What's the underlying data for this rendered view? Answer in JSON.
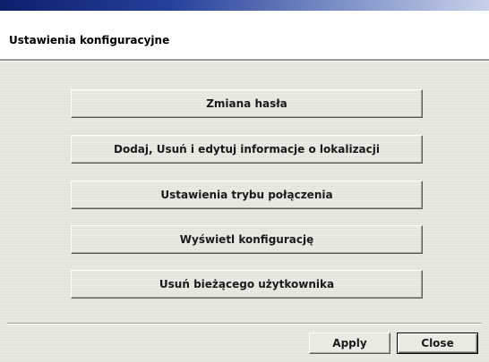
{
  "header": {
    "title": "Ustawienia konfiguracyjne"
  },
  "menu": {
    "buttons": [
      {
        "label": "Zmiana hasła"
      },
      {
        "label": "Dodaj, Usuń i edytuj informacje o lokalizacji"
      },
      {
        "label": "Ustawienia trybu połączenia"
      },
      {
        "label": "Wyświetl konfigurację"
      },
      {
        "label": "Usuń bieżącego użytkownika"
      }
    ]
  },
  "footer": {
    "apply_label": "Apply",
    "close_label": "Close"
  },
  "colors": {
    "titlebar_start": "#0c1f6b",
    "titlebar_end": "#c8d1ea",
    "panel_background": "#e9e8df"
  }
}
